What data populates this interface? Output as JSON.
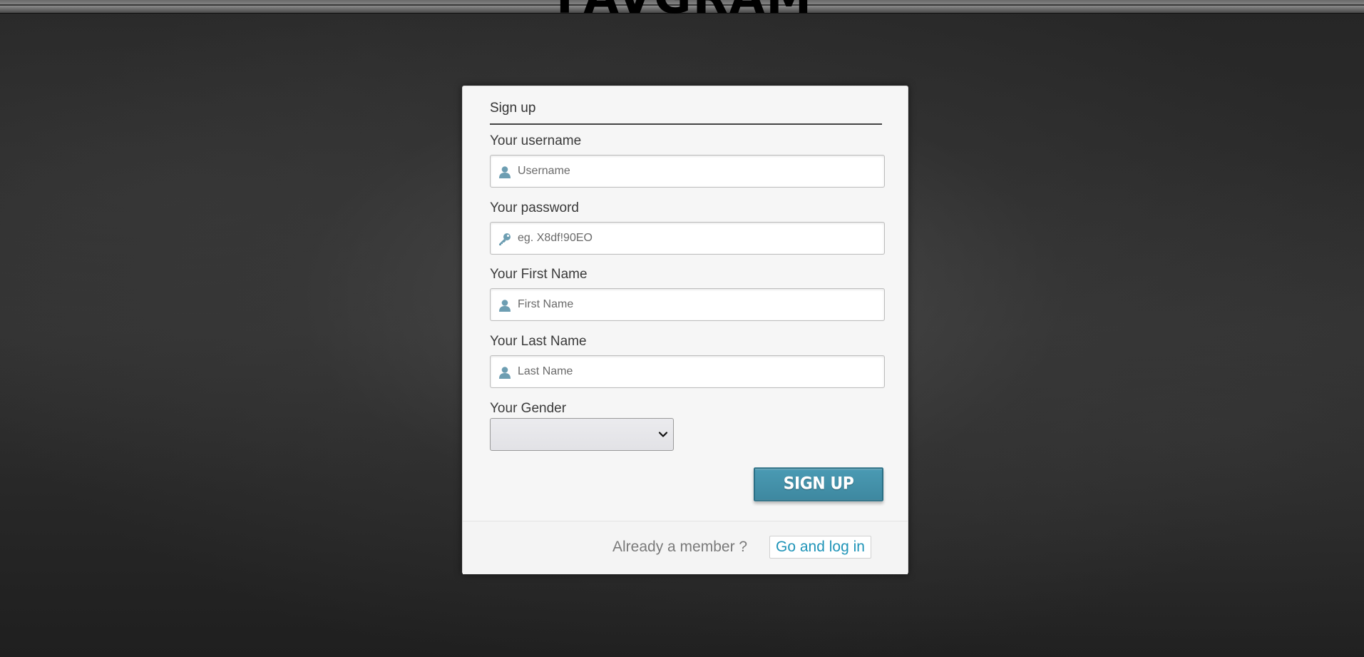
{
  "header": {
    "logo_text": "FAVGRAM"
  },
  "signup_form": {
    "title": "Sign up",
    "username": {
      "label": "Your username",
      "placeholder": "Username",
      "value": "",
      "icon": "user-icon"
    },
    "password": {
      "label": "Your password",
      "placeholder": "eg. X8df!90EO",
      "value": "",
      "icon": "key-icon"
    },
    "first_name": {
      "label": "Your First Name",
      "placeholder": "First Name",
      "value": "",
      "icon": "user-icon"
    },
    "last_name": {
      "label": "Your Last Name",
      "placeholder": "Last Name",
      "value": "",
      "icon": "user-icon"
    },
    "gender": {
      "label": "Your Gender",
      "selected": ""
    },
    "submit_label": "SIGN UP"
  },
  "footer": {
    "prompt": "Already a member ?",
    "login_link": "Go and log in"
  },
  "colors": {
    "accent": "#3e88a0",
    "link": "#1f94b8",
    "icon": "#6d9eb2",
    "background": "#2b2b2b",
    "card": "#f6f6f6"
  }
}
